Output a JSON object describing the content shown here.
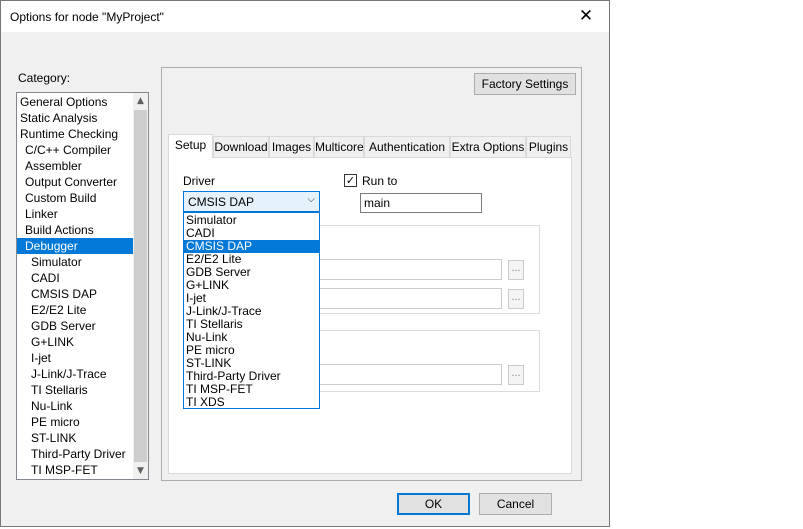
{
  "window": {
    "title": "Options for node \"MyProject\"",
    "close_glyph": "✕"
  },
  "category": {
    "label": "Category:",
    "items": [
      {
        "label": "General Options",
        "indent": 0
      },
      {
        "label": "Static Analysis",
        "indent": 0
      },
      {
        "label": "Runtime Checking",
        "indent": 0
      },
      {
        "label": "C/C++ Compiler",
        "indent": 1
      },
      {
        "label": "Assembler",
        "indent": 1
      },
      {
        "label": "Output Converter",
        "indent": 1
      },
      {
        "label": "Custom Build",
        "indent": 1
      },
      {
        "label": "Linker",
        "indent": 1
      },
      {
        "label": "Build Actions",
        "indent": 1
      },
      {
        "label": "Debugger",
        "indent": 1,
        "selected": true
      },
      {
        "label": "Simulator",
        "indent": 2
      },
      {
        "label": "CADI",
        "indent": 2
      },
      {
        "label": "CMSIS DAP",
        "indent": 2
      },
      {
        "label": "E2/E2 Lite",
        "indent": 2
      },
      {
        "label": "GDB Server",
        "indent": 2
      },
      {
        "label": "G+LINK",
        "indent": 2
      },
      {
        "label": "I-jet",
        "indent": 2
      },
      {
        "label": "J-Link/J-Trace",
        "indent": 2
      },
      {
        "label": "TI Stellaris",
        "indent": 2
      },
      {
        "label": "Nu-Link",
        "indent": 2
      },
      {
        "label": "PE micro",
        "indent": 2
      },
      {
        "label": "ST-LINK",
        "indent": 2
      },
      {
        "label": "Third-Party Driver",
        "indent": 2
      },
      {
        "label": "TI MSP-FET",
        "indent": 2
      }
    ]
  },
  "factory_settings_label": "Factory Settings",
  "tabs": [
    {
      "label": "Setup",
      "active": true
    },
    {
      "label": "Download"
    },
    {
      "label": "Images"
    },
    {
      "label": "Multicore"
    },
    {
      "label": "Authentication"
    },
    {
      "label": "Extra Options"
    },
    {
      "label": "Plugins"
    }
  ],
  "setup": {
    "driver_label": "Driver",
    "driver_value": "CMSIS DAP",
    "driver_options": [
      "Simulator",
      "CADI",
      "CMSIS DAP",
      "E2/E2 Lite",
      "GDB Server",
      "G+LINK",
      "I-jet",
      "J-Link/J-Trace",
      "TI Stellaris",
      "Nu-Link",
      "PE micro",
      "ST-LINK",
      "Third-Party Driver",
      "TI MSP-FET",
      "TI XDS"
    ],
    "driver_selected_index": 2,
    "run_to_label": "Run to",
    "run_to_checked": true,
    "run_to_value": "main",
    "browse_label": "..."
  },
  "footer": {
    "ok_label": "OK",
    "cancel_label": "Cancel"
  }
}
